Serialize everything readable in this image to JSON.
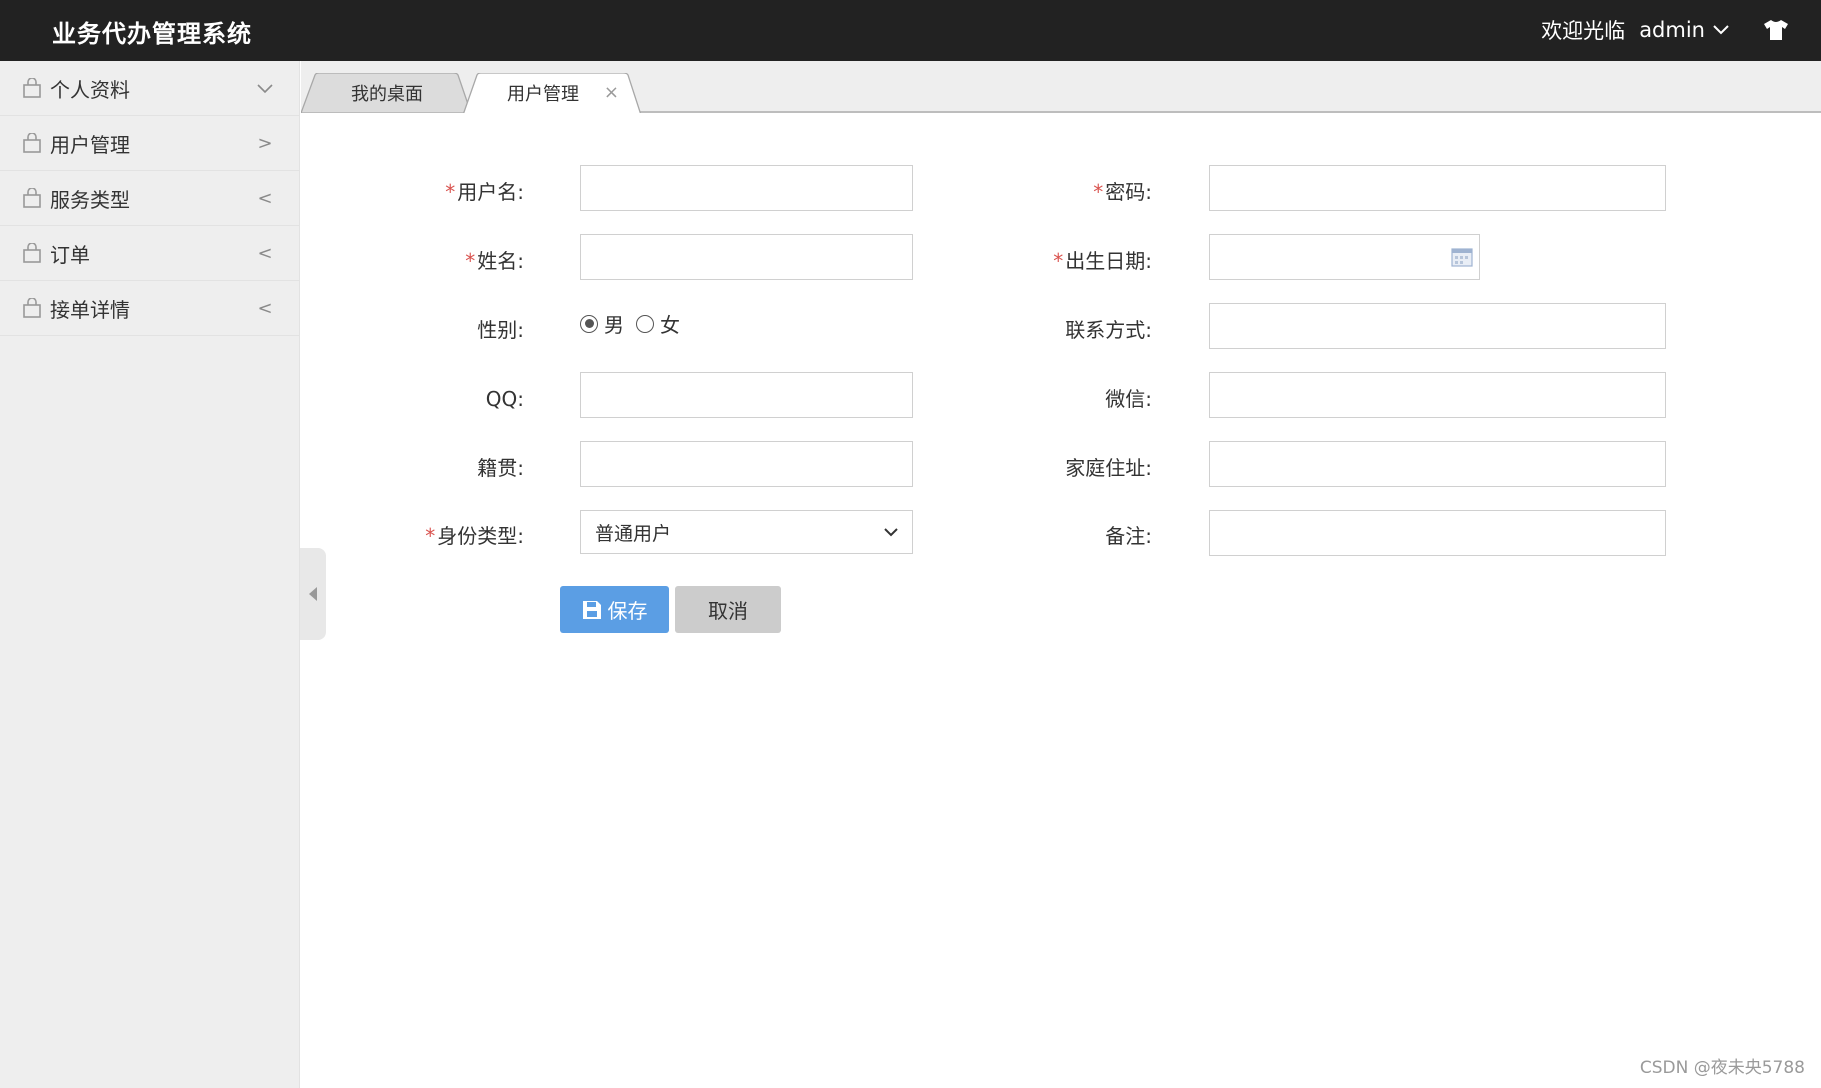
{
  "header": {
    "title": "业务代办管理系统",
    "welcome": "欢迎光临",
    "username": "admin",
    "user_dropdown_icon": "chevron-down-icon",
    "theme_icon": "shirt-icon"
  },
  "sidebar": {
    "items": [
      {
        "label": "个人资料",
        "icon": "shopping-bag-icon",
        "arrow": "∨"
      },
      {
        "label": "用户管理",
        "icon": "shopping-bag-icon",
        "arrow": ">"
      },
      {
        "label": "服务类型",
        "icon": "shopping-bag-icon",
        "arrow": "<"
      },
      {
        "label": "订单",
        "icon": "shopping-bag-icon",
        "arrow": "<"
      },
      {
        "label": "接单详情",
        "icon": "shopping-bag-icon",
        "arrow": "<"
      }
    ]
  },
  "tabs": [
    {
      "label": "我的桌面",
      "active": false
    },
    {
      "label": "用户管理",
      "active": true,
      "close": "×"
    }
  ],
  "form": {
    "required_mark": "*",
    "username_label": "用户名:",
    "username_value": "",
    "password_label": "密码:",
    "password_value": "",
    "name_label": "姓名:",
    "name_value": "",
    "birth_label": "出生日期:",
    "birth_value": "",
    "gender_label": "性别:",
    "gender_options": [
      "男",
      "女"
    ],
    "gender_selected": "男",
    "contact_label": "联系方式:",
    "contact_value": "",
    "qq_label": "QQ:",
    "qq_value": "",
    "wechat_label": "微信:",
    "wechat_value": "",
    "native_label": "籍贯:",
    "native_value": "",
    "address_label": "家庭住址:",
    "address_value": "",
    "idtype_label": "身份类型:",
    "idtype_value": "普通用户",
    "remark_label": "备注:",
    "remark_value": "",
    "save_label": "保存",
    "cancel_label": "取消"
  },
  "colors": {
    "header_bg": "#222222",
    "sidebar_bg": "#eeeeee",
    "save_button": "#5b9ee4",
    "cancel_button": "#cccccc",
    "required": "#d9534f"
  },
  "watermark": "CSDN @夜未央5788"
}
